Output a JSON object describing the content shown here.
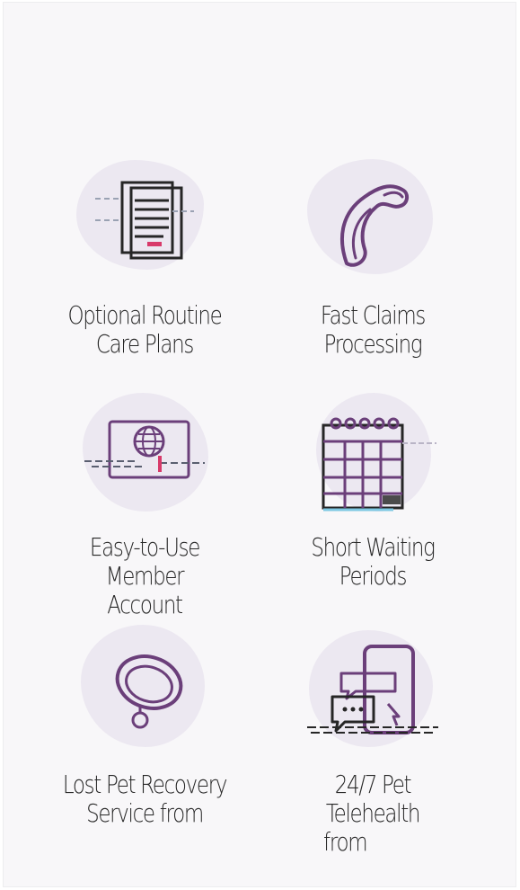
{
  "colors": {
    "background": "#f8f7f9",
    "blob": "#ece8f1",
    "icon_stroke": "#6b3f7a",
    "text": "#262626"
  },
  "features": [
    {
      "icon": "document-stack-icon",
      "label_lines": [
        "Optional Routine",
        "Care Plans"
      ]
    },
    {
      "icon": "boomerang-icon",
      "label_lines": [
        "Fast Claims",
        "Processing"
      ]
    },
    {
      "icon": "globe-monitor-icon",
      "label_lines": [
        "Easy-to-Use Member",
        "Account"
      ]
    },
    {
      "icon": "calendar-icon",
      "label_lines": [
        "Short Waiting",
        "Periods"
      ]
    },
    {
      "icon": "pet-collar-icon",
      "label_lines": [
        "Lost Pet Recovery",
        "Service from"
      ]
    },
    {
      "icon": "phone-chat-icon",
      "label_lines": [
        "24/7 Pet",
        "Telehealth",
        "from"
      ]
    }
  ]
}
